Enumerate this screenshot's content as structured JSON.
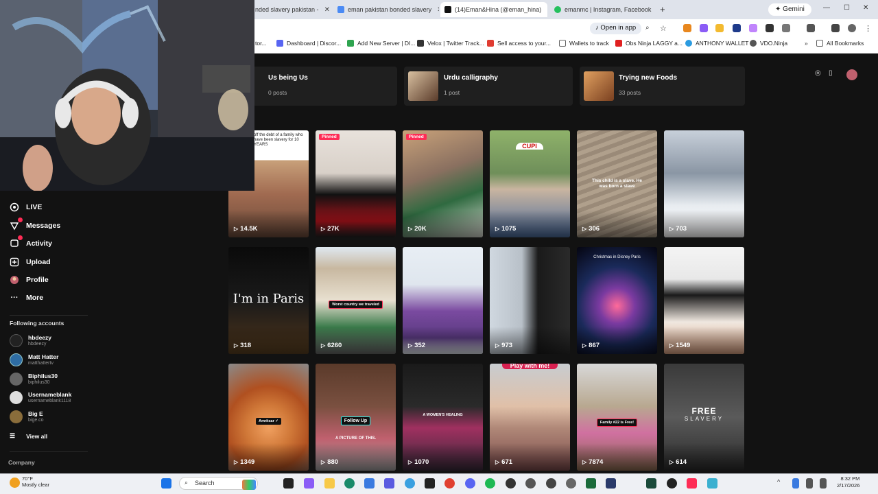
{
  "browser": {
    "tabs": [
      {
        "title": "nded slavery pakistan -",
        "fav": "#4a8af4"
      },
      {
        "title": "eman pakistan bonded slavery",
        "fav": "#4a8af4"
      },
      {
        "title": "(14)Eman&Hina (@eman_hina)",
        "fav": "#111111"
      },
      {
        "title": "emanmc | Instagram, Facebook",
        "fav": "#25c05d"
      }
    ],
    "gemini": "Gemini",
    "open_in_app": "Open in app",
    "bookmarks": [
      {
        "label": "tor...",
        "color": "#888888"
      },
      {
        "label": "Dashboard | Discor...",
        "color": "#5865f2"
      },
      {
        "label": "Add New Server | DI...",
        "color": "#2ea44f"
      },
      {
        "label": "Velox | Twitter Track...",
        "color": "#333333"
      },
      {
        "label": "Sell access to your...",
        "color": "#e03c31"
      },
      {
        "label": "Wallets to track",
        "color": "#999999"
      },
      {
        "label": "Obs Ninja LAGGY a...",
        "color": "#e02020"
      },
      {
        "label": "ANTHONY WALLET",
        "color": "#2b9be0"
      },
      {
        "label": "VDO.Ninja",
        "color": "#555555"
      },
      {
        "label": "All Bookmarks",
        "color": "#999999"
      }
    ]
  },
  "sidebar": {
    "nav": [
      {
        "label": "LIVE",
        "icon": "live-icon"
      },
      {
        "label": "Messages",
        "icon": "messages-icon",
        "badge": true
      },
      {
        "label": "Activity",
        "icon": "activity-icon",
        "badge": true
      },
      {
        "label": "Upload",
        "icon": "upload-icon"
      },
      {
        "label": "Profile",
        "icon": "profile-icon"
      },
      {
        "label": "More",
        "icon": "more-icon"
      }
    ],
    "following_heading": "Following accounts",
    "accounts": [
      {
        "name": "hbdeezy",
        "handle": "hbdeezy",
        "color": "#222222"
      },
      {
        "name": "Matt Hatter",
        "handle": "matthattertv",
        "color": "#2e6da4"
      },
      {
        "name": "Biphilus30",
        "handle": "biphilus30",
        "color": "#666666"
      },
      {
        "name": "Usernameblank",
        "handle": "usernameblank1118",
        "color": "#dddddd"
      },
      {
        "name": "Big E",
        "handle": "bige.co",
        "color": "#8a6d3b"
      }
    ],
    "view_all": "View all",
    "company": "Company"
  },
  "playlists": [
    {
      "title": "Us being Us",
      "count": "0 posts"
    },
    {
      "title": "Urdu calligraphy",
      "count": "1 post"
    },
    {
      "title": "Trying new Foods",
      "count": "33 posts"
    }
  ],
  "videos": [
    {
      "views": "14.5K",
      "caption": "off the debt of a family who have been slavery for 10 YEARS"
    },
    {
      "views": "27K",
      "pinned": "Pinned"
    },
    {
      "views": "20K",
      "pinned": "Pinned"
    },
    {
      "views": "1075",
      "caption": "CUPI"
    },
    {
      "views": "306",
      "caption": "This child is a slave. He was born a slave"
    },
    {
      "views": "703"
    },
    {
      "views": "318",
      "caption": "I'm in Paris"
    },
    {
      "views": "6260",
      "caption": "Worst country we traveled"
    },
    {
      "views": "352"
    },
    {
      "views": "973"
    },
    {
      "views": "867",
      "caption": "Christmas in Disney Paris"
    },
    {
      "views": "1549"
    },
    {
      "views": "1349"
    },
    {
      "views": "880",
      "caption": "Follow Up",
      "caption2": "A PICTURE OF THIS."
    },
    {
      "views": "1070",
      "caption": "A WOMEN'S HEALING"
    },
    {
      "views": "671",
      "caption": "Play with me!"
    },
    {
      "views": "7874",
      "caption": "Family #22 is Free!"
    },
    {
      "views": "614",
      "caption": "FREE",
      "caption2": "SLAVERY"
    }
  ],
  "taskbar": {
    "weather_temp": "70°F",
    "weather_desc": "Mostly clear",
    "search": "Search",
    "time": "8:32 PM",
    "date": "2/17/2026"
  }
}
